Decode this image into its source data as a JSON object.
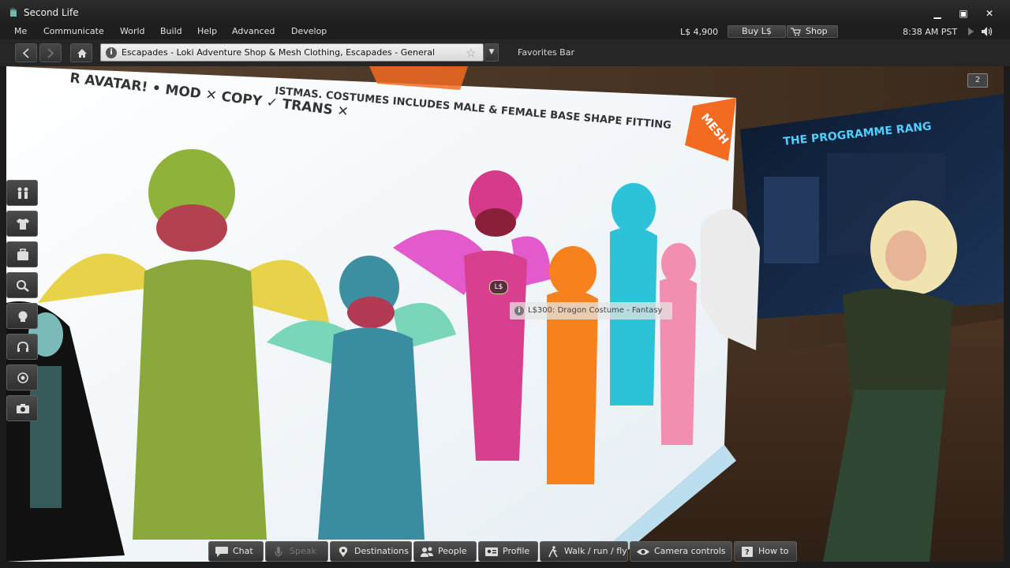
{
  "window": {
    "title": "Second Life"
  },
  "menu": {
    "items": [
      "Me",
      "Communicate",
      "World",
      "Build",
      "Help",
      "Advanced",
      "Develop"
    ],
    "balance": "L$ 4,900",
    "buy_label": "Buy L$",
    "shop_label": "Shop",
    "clock": "8:38 AM PST"
  },
  "nav": {
    "location": "Escapades - Loki Adventure Shop & Mesh Clothing, Escapades - General",
    "favorites": "Favorites Bar"
  },
  "scene": {
    "hud_badge": "2",
    "cursor_price": "L$",
    "hover_tip": "L$300: Dragon Costume - Fantasy",
    "sign_text_1": "R AVATAR! • MOD ✕ COPY ✓ TRANS ✕",
    "sign_text_2": "ISTMAS. COSTUMES INCLUDES MALE & FEMALE BASE SHAPE FITTING",
    "sign_badge": "MESH",
    "panel_title": "THE PROGRAMME RANG"
  },
  "bottombar": {
    "chat": "Chat",
    "speak": "Speak",
    "destinations": "Destinations",
    "people": "People",
    "profile": "Profile",
    "walk": "Walk / run / fly",
    "camera": "Camera controls",
    "howto": "How to"
  },
  "colors": {
    "accent": "#f36a21",
    "chrome": "#1e1e1e"
  }
}
